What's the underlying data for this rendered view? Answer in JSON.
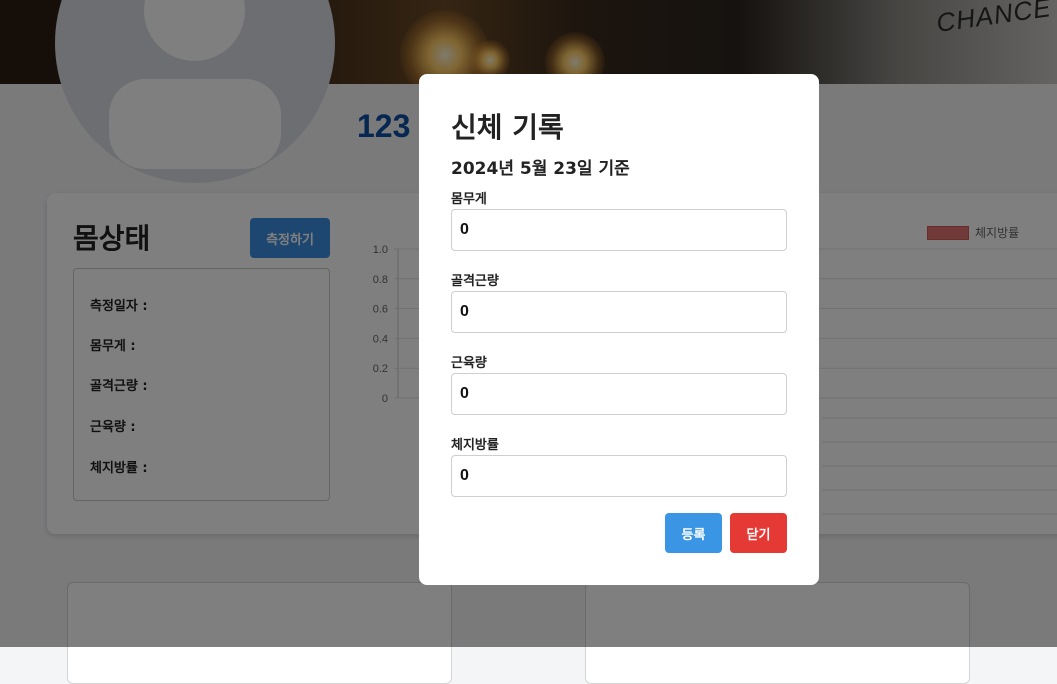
{
  "banner": {
    "sign_text": "CHANCE"
  },
  "profile": {
    "name": "123"
  },
  "body_status": {
    "title": "몸상태",
    "measure_button": "측정하기",
    "rows": [
      {
        "label": "측정일자 :"
      },
      {
        "label": "몸무게 :"
      },
      {
        "label": "골격근량 :"
      },
      {
        "label": "근육량 :"
      },
      {
        "label": "체지방률 :"
      }
    ]
  },
  "chart_data": {
    "type": "bar",
    "series": [
      {
        "name": "체지방률",
        "values": []
      }
    ],
    "yticks": [
      "1.0",
      "0.8",
      "0.6",
      "0.4",
      "0.2",
      "0"
    ],
    "ylim": [
      0,
      1
    ],
    "legend_position": "top-right",
    "legend_color": "#e57373"
  },
  "modal": {
    "title": "신체 기록",
    "date": "2024년 5월 23일 기준",
    "fields": [
      {
        "label": "몸무게",
        "value": "0"
      },
      {
        "label": "골격근량",
        "value": "0"
      },
      {
        "label": "근육량",
        "value": "0"
      },
      {
        "label": "체지방률",
        "value": "0"
      }
    ],
    "register_button": "등록",
    "close_button": "닫기"
  },
  "colors": {
    "primary": "#3a8fe0",
    "danger": "#e53935",
    "name_blue": "#0b4ea2"
  }
}
